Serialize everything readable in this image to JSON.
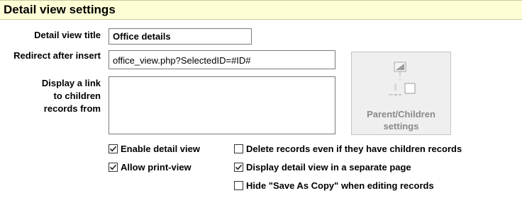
{
  "header": {
    "title": "Detail view settings"
  },
  "form": {
    "detail_view_title_label": "Detail view title",
    "detail_view_title_value": "Office details",
    "redirect_label": "Redirect after insert",
    "redirect_value": "office_view.php?SelectedID=#ID#",
    "children_link_label_line1": "Display a link",
    "children_link_label_line2": "to children",
    "children_link_label_line3": "records from",
    "children_link_value": ""
  },
  "parent_children_button": {
    "label_line1": "Parent/Children",
    "label_line2": "settings",
    "icon": "parent-children-tree-icon",
    "enabled": false
  },
  "options": [
    {
      "label": "Enable detail view",
      "checked": true
    },
    {
      "label": "Allow print-view",
      "checked": true
    },
    {
      "label": "Delete records even if they have children records",
      "checked": false
    },
    {
      "label": "Display detail view in a separate page",
      "checked": true
    },
    {
      "label": "Hide \"Save As Copy\" when editing records",
      "checked": false
    }
  ],
  "colors": {
    "header_bg": "#fefed6",
    "disabled_button_bg": "#efefef",
    "disabled_text": "#8a8a8a"
  }
}
